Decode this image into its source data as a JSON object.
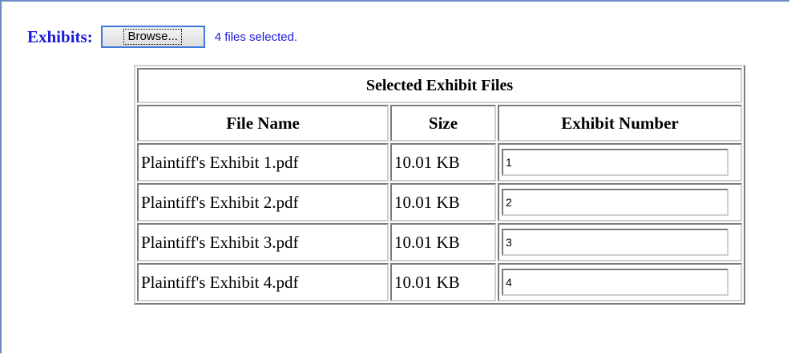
{
  "exhibits": {
    "label": "Exhibits:",
    "browse_label": "Browse...",
    "files_selected": "4 files selected."
  },
  "table": {
    "caption": "Selected Exhibit Files",
    "columns": [
      "File Name",
      "Size",
      "Exhibit Number"
    ],
    "rows": [
      {
        "file_name": "Plaintiff's Exhibit 1.pdf",
        "size": "10.01 KB",
        "exhibit_number": "1"
      },
      {
        "file_name": "Plaintiff's Exhibit 2.pdf",
        "size": "10.01 KB",
        "exhibit_number": "2"
      },
      {
        "file_name": "Plaintiff's Exhibit 3.pdf",
        "size": "10.01 KB",
        "exhibit_number": "3"
      },
      {
        "file_name": "Plaintiff's Exhibit 4.pdf",
        "size": "10.01 KB",
        "exhibit_number": "4"
      }
    ]
  },
  "colors": {
    "label_blue": "#1a1adb",
    "frame_border": "#6b8cc7",
    "button_focus_border": "#3d7bd9"
  }
}
